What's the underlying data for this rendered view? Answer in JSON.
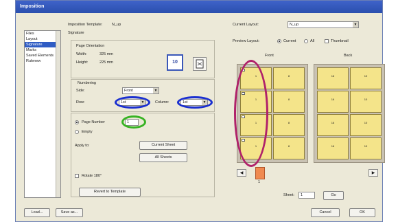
{
  "window": {
    "title": "Imposition"
  },
  "sidebar": {
    "items": [
      {
        "label": "Files"
      },
      {
        "label": "Layout"
      },
      {
        "label": "Signature"
      },
      {
        "label": "Marks"
      },
      {
        "label": "Saved Elements"
      },
      {
        "label": "Rulenew"
      }
    ],
    "active_index": 2
  },
  "template": {
    "label": "Imposition Template:",
    "value": "N_up"
  },
  "signature_label": "Signature",
  "page_orientation": {
    "title": "Page Orientation",
    "width_label": "Width:",
    "width_value": "325 mm",
    "height_label": "Height:",
    "height_value": "225 mm",
    "orientation_icon_text": "10"
  },
  "numbering": {
    "title": "Numbering",
    "side_label": "Side:",
    "side_value": "Front",
    "row_label": "Row:",
    "row_value": "1st",
    "column_label": "Column:",
    "column_value": "1st"
  },
  "options": {
    "page_number_label": "Page Number",
    "page_number_value": "1",
    "empty_label": "Empty",
    "apply_to_label": "Apply to:",
    "current_sheet_button": "Current Sheet",
    "all_sheets_button": "All Sheets",
    "rotate_label": "Rotate 180°",
    "revert_button": "Revert to Template"
  },
  "preview": {
    "current_layout_label": "Current Layout:",
    "current_layout_value": "N_up",
    "preview_layout_label": "Preview Layout:",
    "current_radio": "Current",
    "all_radio": "All",
    "thumbnail_check": "Thumbnail",
    "front_label": "Front",
    "back_label": "Back",
    "front_pages": [
      "1",
      "8",
      "1",
      "8",
      "1",
      "8",
      "1",
      "8"
    ],
    "back_pages": [
      "16",
      "10",
      "16",
      "10",
      "16",
      "10",
      "16",
      "10"
    ],
    "sheet_indicator": "1",
    "sheet_label": "Sheet:",
    "sheet_value": "1",
    "go_button": "Go"
  },
  "footer": {
    "load_button": "Load...",
    "save_button": "Save as...",
    "cancel_button": "Cancel",
    "ok_button": "OK"
  },
  "colors": {
    "accent": "#2f5cc4",
    "page_fill": "#f4e48a",
    "highlight_magenta": "#b0226a",
    "highlight_blue": "#1a2fd0",
    "highlight_green": "#38b324",
    "sheet_indicator": "#f08a50"
  }
}
